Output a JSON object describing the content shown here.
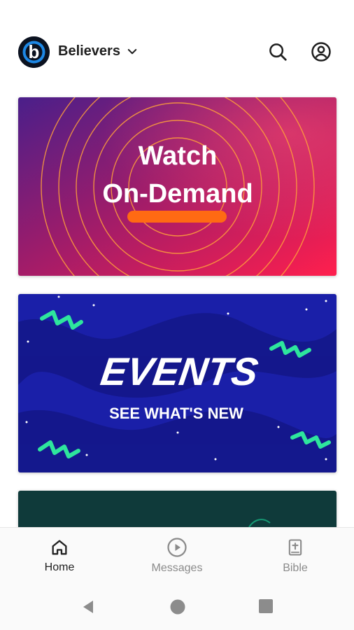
{
  "header": {
    "org_name": "Believers",
    "logo_letter": "b",
    "icons": [
      "chevron-down-icon",
      "search-icon",
      "account-icon"
    ]
  },
  "cards": [
    {
      "line1": "Watch",
      "line2": "On-Demand",
      "accent": "#ff6a13"
    },
    {
      "title": "EVENTS",
      "subtitle": "SEE WHAT'S NEW",
      "accent": "#2ee59d"
    }
  ],
  "bottom_nav": {
    "items": [
      {
        "label": "Home",
        "icon": "home-icon",
        "active": true
      },
      {
        "label": "Messages",
        "icon": "play-circle-icon",
        "active": false
      },
      {
        "label": "Bible",
        "icon": "bible-icon",
        "active": false
      }
    ],
    "active_color": "#222222",
    "inactive_color": "#8a8a8a"
  },
  "system_nav": [
    "back-icon",
    "home-circle-icon",
    "recents-icon"
  ]
}
